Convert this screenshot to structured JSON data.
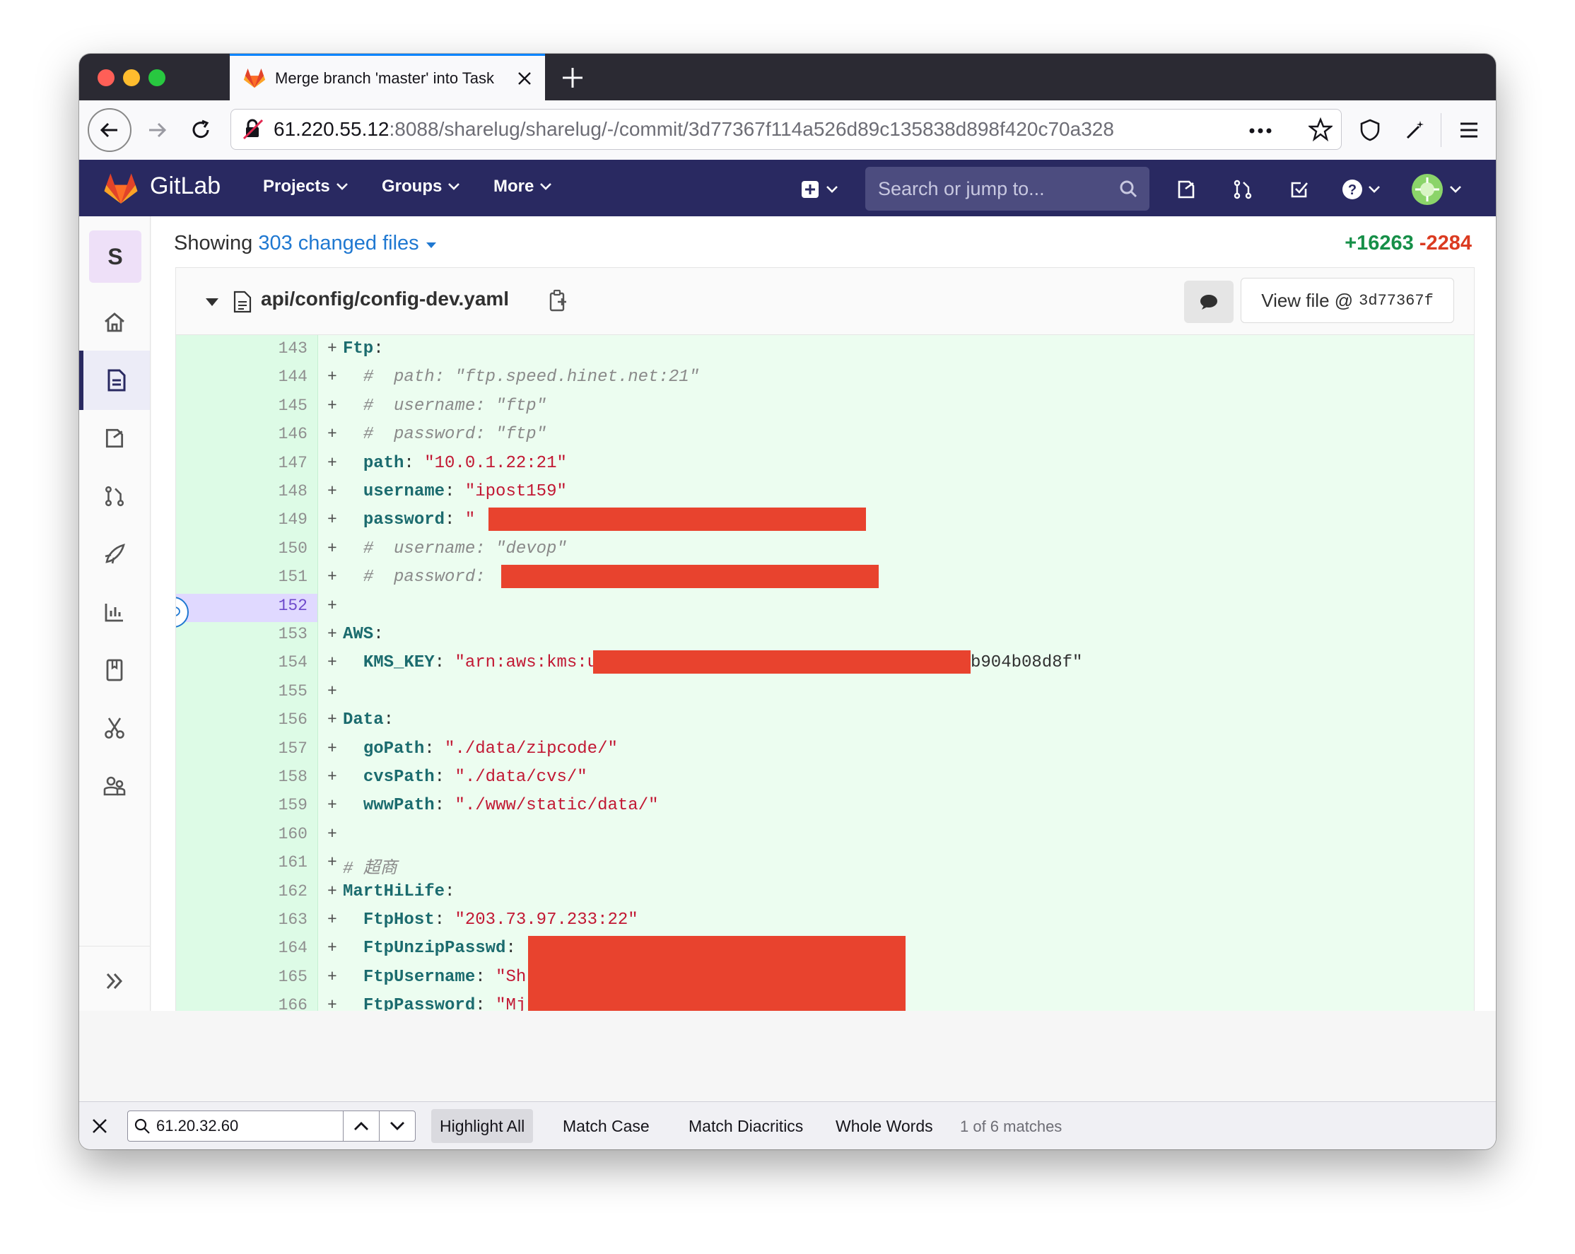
{
  "browser": {
    "tab_title": "Merge branch 'master' into Task",
    "url_host": "61.220.55.12",
    "url_rest": ":8088/sharelug/sharelug/-/commit/3d77367f114a526d89c135838d898f420c70a328",
    "traffic_colors": [
      "#ff5f57",
      "#febc2e",
      "#28c840"
    ]
  },
  "gitlab": {
    "logo_text": "GitLab",
    "nav": [
      "Projects",
      "Groups",
      "More"
    ],
    "search_placeholder": "Search or jump to...",
    "project_initial": "S"
  },
  "commit": {
    "showing_prefix": "Showing",
    "changed_files": "303 changed files",
    "additions": "+16263",
    "deletions": "-2284"
  },
  "file": {
    "path": "api/config/config-dev.yaml",
    "view_file_label": "View file @",
    "view_file_sha": "3d77367f"
  },
  "diff_lines": [
    {
      "n": "143",
      "t": [
        [
          "k",
          "Ftp"
        ],
        [
          "p",
          ":"
        ]
      ]
    },
    {
      "n": "144",
      "t": [
        [
          "p",
          "  "
        ],
        [
          "c",
          "#  path: \"ftp.speed.hinet.net:21\""
        ]
      ]
    },
    {
      "n": "145",
      "t": [
        [
          "p",
          "  "
        ],
        [
          "c",
          "#  username: \"ftp\""
        ]
      ]
    },
    {
      "n": "146",
      "t": [
        [
          "p",
          "  "
        ],
        [
          "c",
          "#  password: \"ftp\""
        ]
      ]
    },
    {
      "n": "147",
      "t": [
        [
          "p",
          "  "
        ],
        [
          "k",
          "path"
        ],
        [
          "p",
          ": "
        ],
        [
          "s",
          "\"10.0.1.22:21\""
        ]
      ]
    },
    {
      "n": "148",
      "t": [
        [
          "p",
          "  "
        ],
        [
          "k",
          "username"
        ],
        [
          "p",
          ": "
        ],
        [
          "s",
          "\"ipost159\""
        ]
      ]
    },
    {
      "n": "149",
      "t": [
        [
          "p",
          "  "
        ],
        [
          "k",
          "password"
        ],
        [
          "p",
          ": "
        ],
        [
          "s",
          "\""
        ]
      ]
    },
    {
      "n": "150",
      "t": [
        [
          "p",
          "  "
        ],
        [
          "c",
          "#  username: \"devop\""
        ]
      ]
    },
    {
      "n": "151",
      "t": [
        [
          "p",
          "  "
        ],
        [
          "c",
          "#  password:"
        ]
      ]
    },
    {
      "n": "152",
      "t": []
    },
    {
      "n": "153",
      "t": [
        [
          "k",
          "AWS"
        ],
        [
          "p",
          ":"
        ]
      ]
    },
    {
      "n": "154",
      "t": [
        [
          "p",
          "  "
        ],
        [
          "k",
          "KMS_KEY"
        ],
        [
          "p",
          ": "
        ],
        [
          "s",
          "\"arn:aws:kms:us-"
        ]
      ]
    },
    {
      "n": "155",
      "t": []
    },
    {
      "n": "156",
      "t": [
        [
          "k",
          "Data"
        ],
        [
          "p",
          ":"
        ]
      ]
    },
    {
      "n": "157",
      "t": [
        [
          "p",
          "  "
        ],
        [
          "k",
          "goPath"
        ],
        [
          "p",
          ": "
        ],
        [
          "s",
          "\"./data/zipcode/\""
        ]
      ]
    },
    {
      "n": "158",
      "t": [
        [
          "p",
          "  "
        ],
        [
          "k",
          "cvsPath"
        ],
        [
          "p",
          ": "
        ],
        [
          "s",
          "\"./data/cvs/\""
        ]
      ]
    },
    {
      "n": "159",
      "t": [
        [
          "p",
          "  "
        ],
        [
          "k",
          "wwwPath"
        ],
        [
          "p",
          ": "
        ],
        [
          "s",
          "\"./www/static/data/\""
        ]
      ]
    },
    {
      "n": "160",
      "t": []
    },
    {
      "n": "161",
      "t": [
        [
          "c",
          "# 超商"
        ]
      ]
    },
    {
      "n": "162",
      "t": [
        [
          "k",
          "MartHiLife"
        ],
        [
          "p",
          ":"
        ]
      ]
    },
    {
      "n": "163",
      "t": [
        [
          "p",
          "  "
        ],
        [
          "k",
          "FtpHost"
        ],
        [
          "p",
          ": "
        ],
        [
          "s",
          "\"203.73.97.233:22\""
        ]
      ]
    },
    {
      "n": "164",
      "t": [
        [
          "p",
          "  "
        ],
        [
          "k",
          "FtpUnzipPasswd"
        ],
        [
          "p",
          ":"
        ]
      ]
    },
    {
      "n": "165",
      "t": [
        [
          "p",
          "  "
        ],
        [
          "k",
          "FtpUsername"
        ],
        [
          "p",
          ": "
        ],
        [
          "s",
          "\"Sh"
        ]
      ]
    },
    {
      "n": "166",
      "t": [
        [
          "p",
          "  "
        ],
        [
          "k",
          "FtpPassword"
        ],
        [
          "p",
          ": "
        ],
        [
          "s",
          "\"Mj"
        ]
      ]
    }
  ],
  "kms_suffix": "b904b08d8f\"",
  "findbar": {
    "query": "61.20.32.60",
    "highlight_all": "Highlight All",
    "match_case": "Match Case",
    "match_diacritics": "Match Diacritics",
    "whole_words": "Whole Words",
    "count": "1 of 6 matches"
  },
  "colors": {
    "gitlab_header": "#292961",
    "added_bg": "#ecfdf0",
    "redaction": "#e8432e",
    "additions": "#168f48",
    "deletions": "#db3b21"
  }
}
